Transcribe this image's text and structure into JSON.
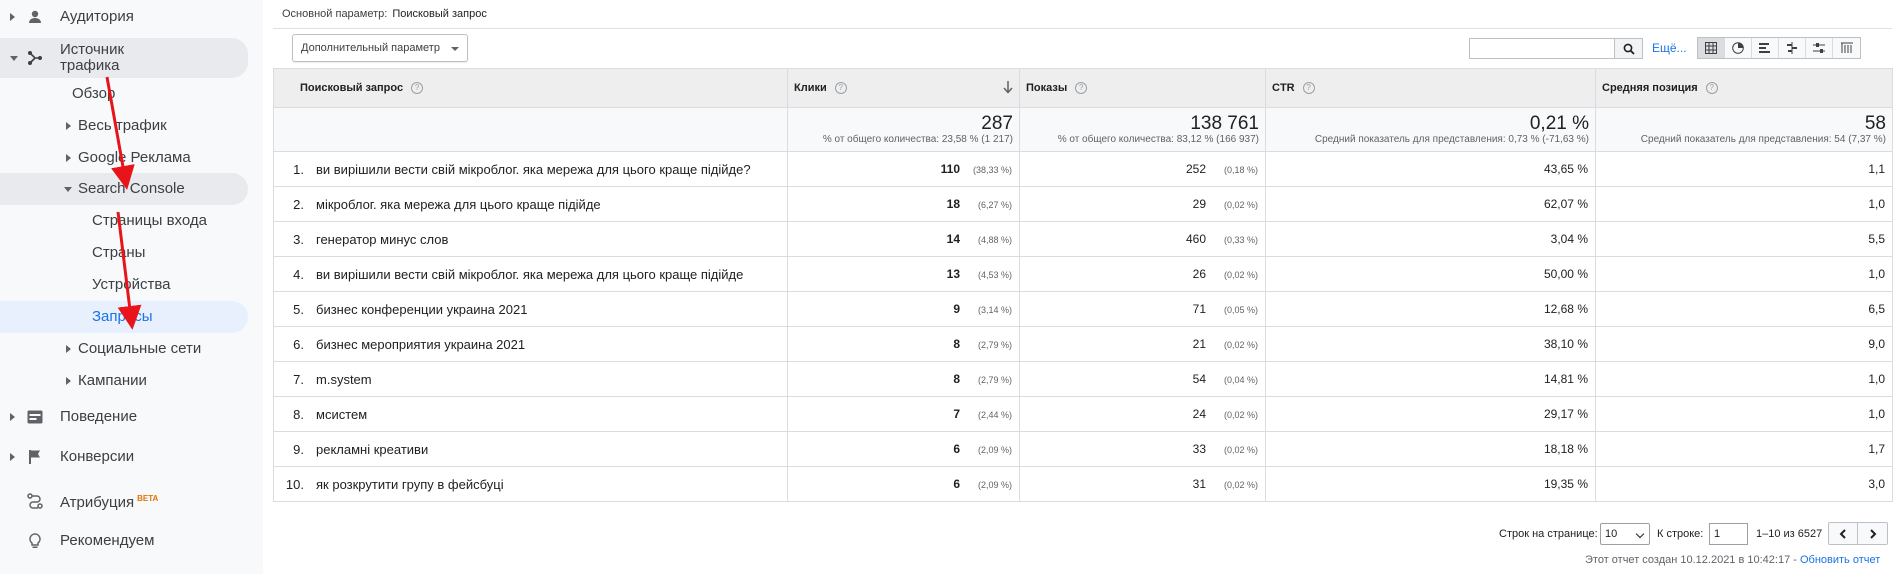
{
  "sidebar": {
    "audience": "Аудитория",
    "traffic_source": "Источник трафика",
    "overview": "Обзор",
    "all_traffic": "Весь трафик",
    "google_ads": "Google Реклама",
    "search_console": "Search Console",
    "landing_pages": "Страницы входа",
    "countries": "Страны",
    "devices": "Устройства",
    "queries": "Запросы",
    "social": "Социальные сети",
    "campaigns": "Кампании",
    "behavior": "Поведение",
    "conversions": "Конверсии",
    "attribution": "Атрибуция",
    "attribution_badge": "BETA",
    "recommended": "Рекомендуем"
  },
  "toolbar": {
    "primary_dimension_label": "Основной параметр:",
    "primary_dimension_value": "Поисковый запрос",
    "secondary_dimension": "Дополнительный параметр",
    "search_value": "",
    "more_link": "Ещё..."
  },
  "table": {
    "headers": {
      "query": "Поисковый запрос",
      "clicks": "Клики",
      "impressions": "Показы",
      "ctr": "CTR",
      "position": "Средняя позиция"
    },
    "summary": {
      "clicks": "287",
      "clicks_note": "% от общего количества: 23,58 % (1 217)",
      "impressions": "138 761",
      "impressions_note": "% от общего количества: 83,12 % (166 937)",
      "ctr": "0,21 %",
      "ctr_note": "Средний показатель для представления: 0,73 % (-71,63 %)",
      "position": "58",
      "position_note": "Средний показатель для представления: 54 (7,37 %)"
    },
    "rows": [
      {
        "n": "1.",
        "query": "ви вирішили вести свій мікроблог. яка мережа для цього краще підійде?",
        "clicks": "110",
        "clicks_pct": "(38,33 %)",
        "impr": "252",
        "impr_pct": "(0,18 %)",
        "ctr": "43,65 %",
        "pos": "1,1"
      },
      {
        "n": "2.",
        "query": "мікроблог. яка мережа для цього краще підійде",
        "clicks": "18",
        "clicks_pct": "(6,27 %)",
        "impr": "29",
        "impr_pct": "(0,02 %)",
        "ctr": "62,07 %",
        "pos": "1,0"
      },
      {
        "n": "3.",
        "query": "генератор минус слов",
        "clicks": "14",
        "clicks_pct": "(4,88 %)",
        "impr": "460",
        "impr_pct": "(0,33 %)",
        "ctr": "3,04 %",
        "pos": "5,5"
      },
      {
        "n": "4.",
        "query": "ви вирішили вести свій мікроблог. яка мережа для цього краще підійде",
        "clicks": "13",
        "clicks_pct": "(4,53 %)",
        "impr": "26",
        "impr_pct": "(0,02 %)",
        "ctr": "50,00 %",
        "pos": "1,0"
      },
      {
        "n": "5.",
        "query": "бизнес конференции украина 2021",
        "clicks": "9",
        "clicks_pct": "(3,14 %)",
        "impr": "71",
        "impr_pct": "(0,05 %)",
        "ctr": "12,68 %",
        "pos": "6,5"
      },
      {
        "n": "6.",
        "query": "бизнес мероприятия украина 2021",
        "clicks": "8",
        "clicks_pct": "(2,79 %)",
        "impr": "21",
        "impr_pct": "(0,02 %)",
        "ctr": "38,10 %",
        "pos": "9,0"
      },
      {
        "n": "7.",
        "query": "m.system",
        "clicks": "8",
        "clicks_pct": "(2,79 %)",
        "impr": "54",
        "impr_pct": "(0,04 %)",
        "ctr": "14,81 %",
        "pos": "1,0"
      },
      {
        "n": "8.",
        "query": "мсистем",
        "clicks": "7",
        "clicks_pct": "(2,44 %)",
        "impr": "24",
        "impr_pct": "(0,02 %)",
        "ctr": "29,17 %",
        "pos": "1,0"
      },
      {
        "n": "9.",
        "query": "рекламні креативи",
        "clicks": "6",
        "clicks_pct": "(2,09 %)",
        "impr": "33",
        "impr_pct": "(0,02 %)",
        "ctr": "18,18 %",
        "pos": "1,7"
      },
      {
        "n": "10.",
        "query": "як розкрутити групу в фейсбуці",
        "clicks": "6",
        "clicks_pct": "(2,09 %)",
        "impr": "31",
        "impr_pct": "(0,02 %)",
        "ctr": "19,35 %",
        "pos": "3,0"
      }
    ]
  },
  "pager": {
    "rows_label": "Строк на странице:",
    "rows_value": "10",
    "goto_label": "К строке:",
    "goto_value": "1",
    "range": "1–10 из 6527"
  },
  "report": {
    "created": "Этот отчет создан 10.12.2021 в 10:42:17 -",
    "refresh": "Обновить отчет"
  },
  "colors": {
    "accent": "#1a73e8",
    "annotation_arrow": "#e8141a",
    "beta": "#e37400"
  }
}
